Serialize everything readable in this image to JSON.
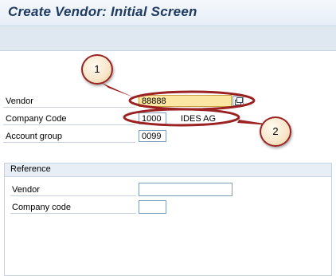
{
  "window": {
    "title": "Create Vendor:  Initial Screen"
  },
  "form": {
    "vendor": {
      "label": "Vendor",
      "value": "88888"
    },
    "company_code": {
      "label": "Company Code",
      "value": "1000",
      "description": "IDES AG"
    },
    "account_group": {
      "label": "Account group",
      "value": "0099"
    }
  },
  "reference": {
    "title": "Reference",
    "vendor": {
      "label": "Vendor",
      "value": ""
    },
    "company_code": {
      "label": "Company code",
      "value": ""
    }
  },
  "annotations": [
    {
      "label": "1"
    },
    {
      "label": "2"
    }
  ],
  "colors": {
    "title_text": "#1f3a63",
    "active_field": "#fbe6a4",
    "annotation_stroke": "#9b2222"
  }
}
